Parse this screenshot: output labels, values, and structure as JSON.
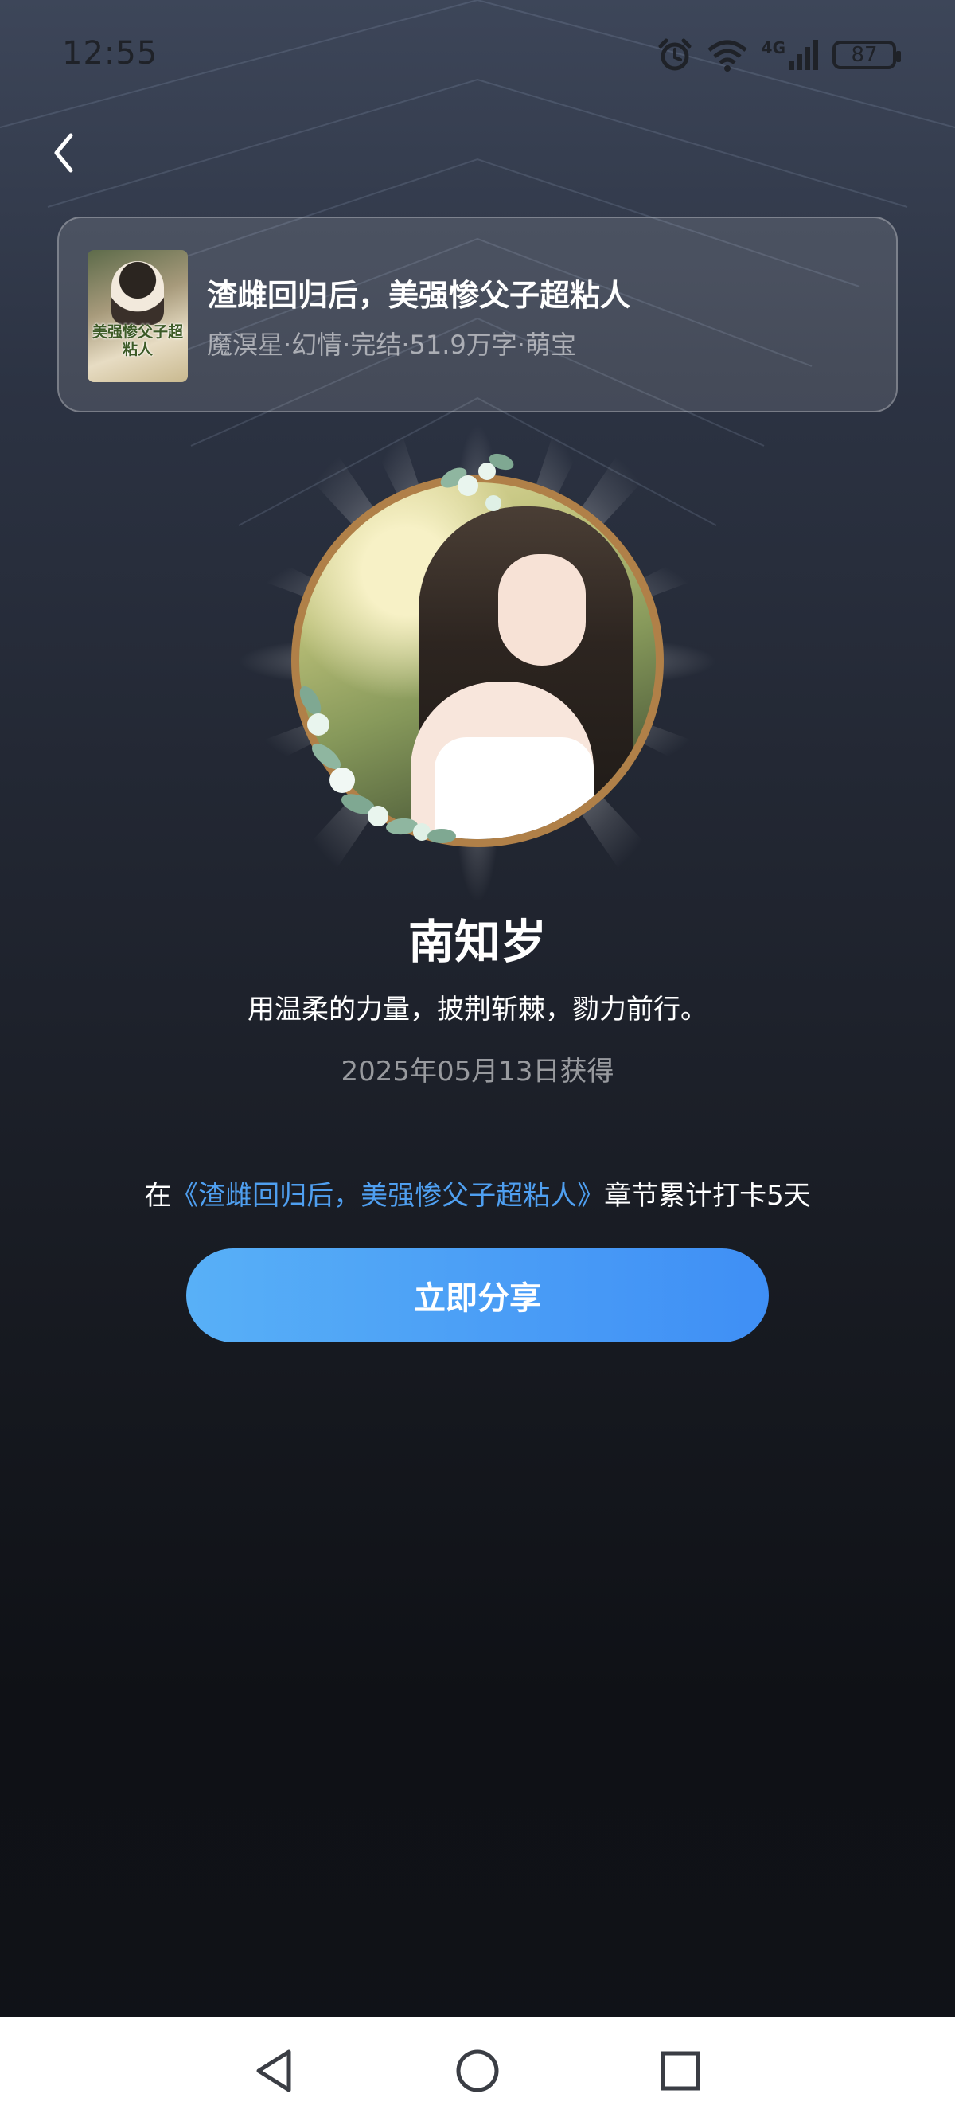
{
  "status_bar": {
    "time": "12:55",
    "network": "4G",
    "battery": "87",
    "icons": [
      "alarm-icon",
      "wifi-icon",
      "signal-icon",
      "battery-icon"
    ]
  },
  "header": {
    "back_icon": "chevron-left-icon"
  },
  "book": {
    "cover_text": "美强惨父子超粘人",
    "title": "渣雌回归后，美强惨父子超粘人",
    "meta": "魔溟星·幻情·完结·51.9万字·萌宝"
  },
  "badge": {
    "name": "南知岁",
    "motto": "用温柔的力量，披荆斩棘，勠力前行。",
    "obtained_date": "2025年05月13日获得"
  },
  "checkin": {
    "prefix": "在",
    "book_link": "《渣雌回归后，美强惨父子超粘人》",
    "suffix": "章节累计打卡5天"
  },
  "actions": {
    "share_label": "立即分享"
  },
  "nav": {
    "icons": [
      "nav-back-icon",
      "nav-home-icon",
      "nav-recents-icon"
    ]
  },
  "colors": {
    "accent": "#4a9df6",
    "link": "#4f9ff0",
    "badge_ring": "#b08048"
  }
}
